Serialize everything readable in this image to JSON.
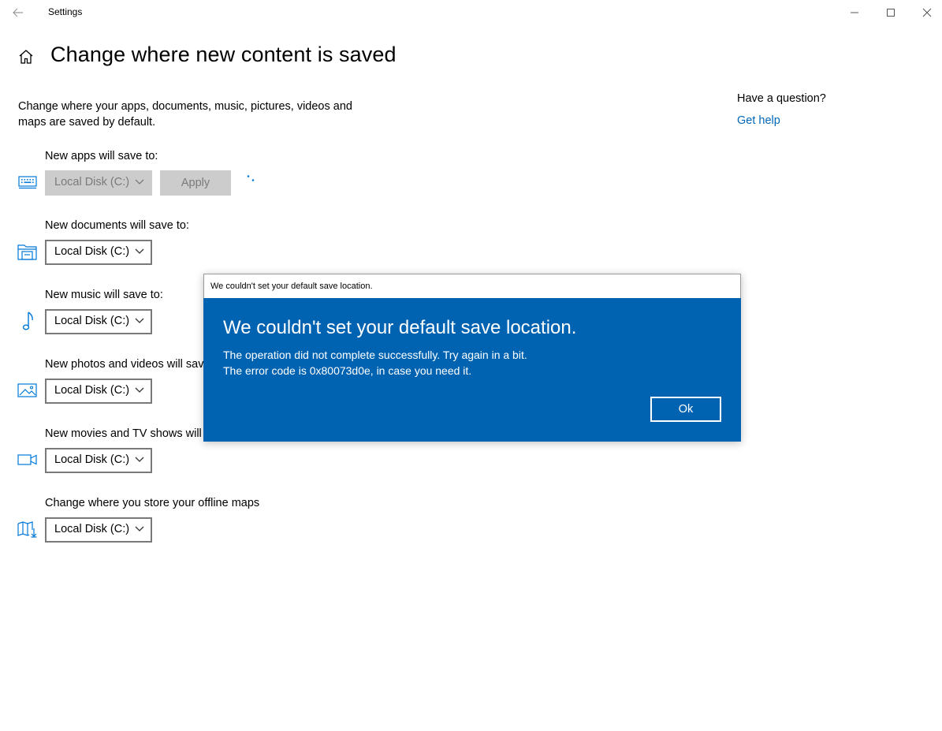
{
  "window": {
    "title": "Settings",
    "controls": {
      "minimize": "minimize-icon",
      "maximize": "maximize-icon",
      "close": "close-icon"
    }
  },
  "page": {
    "title": "Change where new content is saved",
    "description": "Change where your apps, documents, music, pictures, videos and maps are saved by default."
  },
  "sections": [
    {
      "label": "New apps will save to:",
      "icon": "keyboard-icon",
      "value": "Local Disk (C:)",
      "disabled": true
    },
    {
      "label": "New documents will save to:",
      "icon": "documents-folder-icon",
      "value": "Local Disk (C:)"
    },
    {
      "label": "New music will save to:",
      "icon": "music-note-icon",
      "value": "Local Disk (C:)"
    },
    {
      "label": "New photos and videos will save to:",
      "icon": "picture-icon",
      "value": "Local Disk (C:)"
    },
    {
      "label": "New movies and TV shows will save to:",
      "icon": "video-camera-icon",
      "value": "Local Disk (C:)"
    },
    {
      "label": "Change where you store your offline maps",
      "icon": "map-download-icon",
      "value": "Local Disk (C:)"
    }
  ],
  "apply_button": {
    "label": "Apply",
    "disabled": true
  },
  "help": {
    "heading": "Have a question?",
    "link": "Get help"
  },
  "dialog": {
    "window_title": "We couldn't set your default save location.",
    "heading": "We couldn't set your default save location.",
    "message_line1": "The operation did not complete successfully. Try again in a bit.",
    "message_line2": "The error code is 0x80073d0e, in case you need it.",
    "ok_label": "Ok"
  },
  "colors": {
    "accent": "#0063b1",
    "link": "#0067b8",
    "icon": "#0078d7",
    "disabled_bg": "#cccccc",
    "disabled_text": "#7a7a7a"
  }
}
